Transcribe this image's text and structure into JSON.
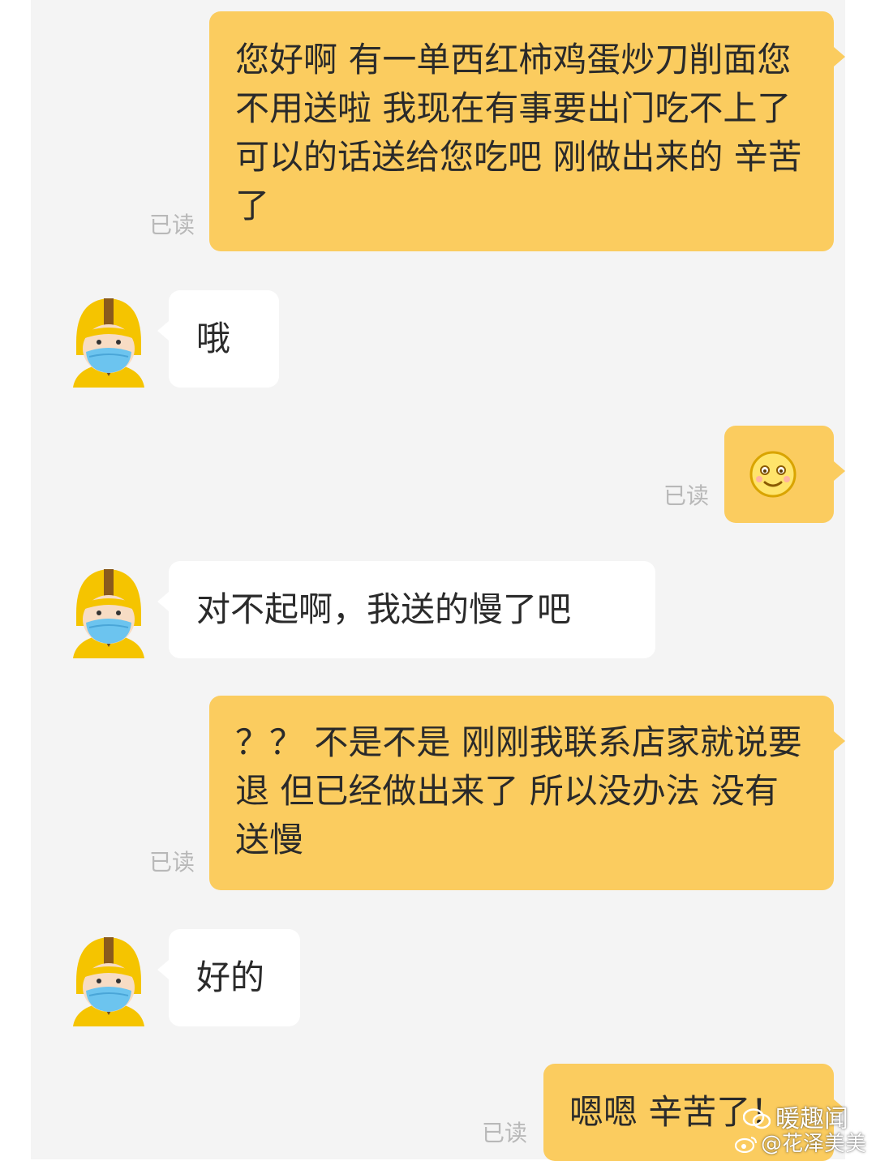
{
  "read_label": "已读",
  "messages": [
    {
      "text": "您好啊 有一单西红柿鸡蛋炒刀削面您不用送啦 我现在有事要出门吃不上了 可以的话送给您吃吧 刚做出来的 辛苦了",
      "status": "已读"
    },
    {
      "text": "哦"
    },
    {
      "emoji": "smiling-face",
      "status": "已读"
    },
    {
      "text": "对不起啊，我送的慢了吧"
    },
    {
      "text": "？？ 不是不是 刚刚我联系店家就说要退 但已经做出来了 所以没办法 没有送慢",
      "status": "已读"
    },
    {
      "text": "好的"
    },
    {
      "text": "嗯嗯 辛苦了！",
      "status": "已读"
    }
  ],
  "watermarks": {
    "top": "暖趣闻",
    "bottom": "@花泽美美"
  },
  "colors": {
    "sent_bubble": "#fbcc5f",
    "received_bubble": "#ffffff",
    "background": "#f4f4f4",
    "read_text": "#b8b8b8"
  }
}
